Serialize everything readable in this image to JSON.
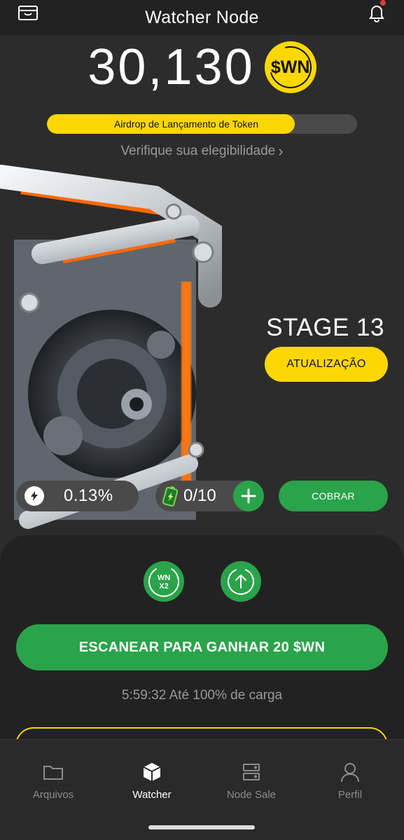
{
  "header": {
    "title": "Watcher Node"
  },
  "balance": {
    "value": "30,130",
    "token": "$WN"
  },
  "airdrop": {
    "label": "Airdrop de Lançamento de Token",
    "progress": 0.8
  },
  "eligibility": {
    "label": "Verifique sua elegibilidade",
    "chevron": "›"
  },
  "stage": {
    "label": "STAGE 13",
    "upgrade_label": "ATUALIZAÇÃO"
  },
  "stats": {
    "rate": "0.13%",
    "battery": "0/10",
    "collect_label": "COBRAR"
  },
  "actions": {
    "boost_line1": "WN",
    "boost_line2": "X2",
    "scan_label": "ESCANEAR PARA GANHAR 20 $WN",
    "charge_info": "5:59:32 Até 100% de carga"
  },
  "nav": {
    "items": [
      {
        "label": "Arquivos",
        "icon": "folder-icon",
        "active": false
      },
      {
        "label": "Watcher",
        "icon": "cube-icon",
        "active": true
      },
      {
        "label": "Node Sale",
        "icon": "server-icon",
        "active": false
      },
      {
        "label": "Perfil",
        "icon": "user-icon",
        "active": false
      }
    ]
  },
  "colors": {
    "accent_yellow": "#fcd704",
    "accent_green": "#2aa34a",
    "background": "#2c2c2c",
    "glow_orange": "#ff6a00"
  }
}
